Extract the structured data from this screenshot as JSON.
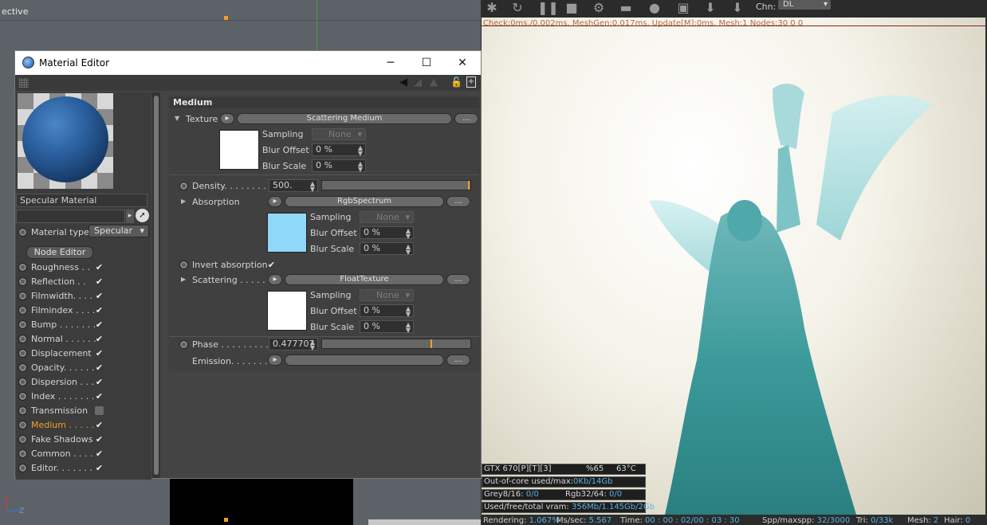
{
  "viewport": {
    "label": "ective"
  },
  "render": {
    "status": "Check:0ms./0.002ms. MeshGen:0.017ms. Update[M]:0ms. Mesh:1 Nodes:30 0 0",
    "chn_label": "Chn:",
    "chn_value": "DL",
    "gpu": {
      "name": "GTX 670[P][T][3]",
      "pct": "%65",
      "temp": "63°C"
    },
    "out_of_core_label": "Out-of-core used/max:",
    "out_of_core_value": "0Kb/14Gb",
    "grey_label": "Grey8/16:",
    "grey_value": "0/0",
    "rgb_label": "Rgb32/64:",
    "rgb_value": "0/0",
    "vram_label": "Used/free/total vram:",
    "vram_value": "356Mb/1.145Gb/2Gb",
    "bottom": {
      "rendering_label": "Rendering:",
      "rendering_value": "1.067%",
      "ms_label": "Ms/sec:",
      "ms_value": "5.567",
      "time_label": "Time:",
      "time_value": "00 : 00 : 02/00 : 03 : 30",
      "spp_label": "Spp/maxspp:",
      "spp_value": "32/3000",
      "tri_label": "Tri:",
      "tri_value": "0/33k",
      "mesh_label": "Mesh:",
      "mesh_value": "2",
      "hair_label": "Hair:",
      "hair_value": "0"
    }
  },
  "material_editor": {
    "title": "Material Editor",
    "material_name": "Specular Material",
    "material_type_label": "Material type",
    "material_type_value": "Specular",
    "node_editor": "Node Editor",
    "channels": [
      {
        "label": "Roughness . .",
        "checked": true,
        "active": false
      },
      {
        "label": "Reflection . .",
        "checked": true,
        "active": false
      },
      {
        "label": "Filmwidth. . . .",
        "checked": true,
        "active": false
      },
      {
        "label": "Filmindex . . . .",
        "checked": true,
        "active": false
      },
      {
        "label": "Bump . . . . . . .",
        "checked": true,
        "active": false
      },
      {
        "label": "Normal . . . . . .",
        "checked": true,
        "active": false
      },
      {
        "label": "Displacement",
        "checked": true,
        "active": false
      },
      {
        "label": "Opacity. . . . . .",
        "checked": true,
        "active": false
      },
      {
        "label": "Dispersion . . .",
        "checked": true,
        "active": false
      },
      {
        "label": "Index . . . . . . .",
        "checked": true,
        "active": false
      },
      {
        "label": "Transmission",
        "checked": false,
        "active": false
      },
      {
        "label": "Medium . . . . .",
        "checked": true,
        "active": true
      },
      {
        "label": "Fake Shadows",
        "checked": true,
        "active": false
      },
      {
        "label": "Common . . . .",
        "checked": true,
        "active": false
      },
      {
        "label": "Editor. . . . . . .",
        "checked": true,
        "active": false
      }
    ],
    "section_title": "Medium",
    "texture_label": "Texture",
    "texture_value": "Scattering Medium",
    "more_btn": "...",
    "sampling_label": "Sampling",
    "sampling_value": "None",
    "blur_offset_label": "Blur Offset",
    "blur_offset_value": "0 %",
    "blur_scale_label": "Blur Scale",
    "blur_scale_value": "0 %",
    "density_label": "Density. . . . . . . .",
    "density_value": "500.",
    "density_slider_fraction": 0.99,
    "absorption_label": "Absorption",
    "absorption_value": "RgbSpectrum",
    "absorption_color": "#8fd8f8",
    "invert_label": "Invert absorption",
    "scattering_label": "Scattering . . . . . .",
    "scattering_value": "FloatTexture",
    "phase_label": "Phase . . . . . . . . . .",
    "phase_value": "0.477707",
    "phase_slider_fraction": 0.739,
    "emission_label": "Emission. . . . . . . ."
  },
  "colors": {
    "accent": "#f0a020",
    "active_channel": "#f0a020",
    "stat_highlight": "#5ab0e0"
  }
}
